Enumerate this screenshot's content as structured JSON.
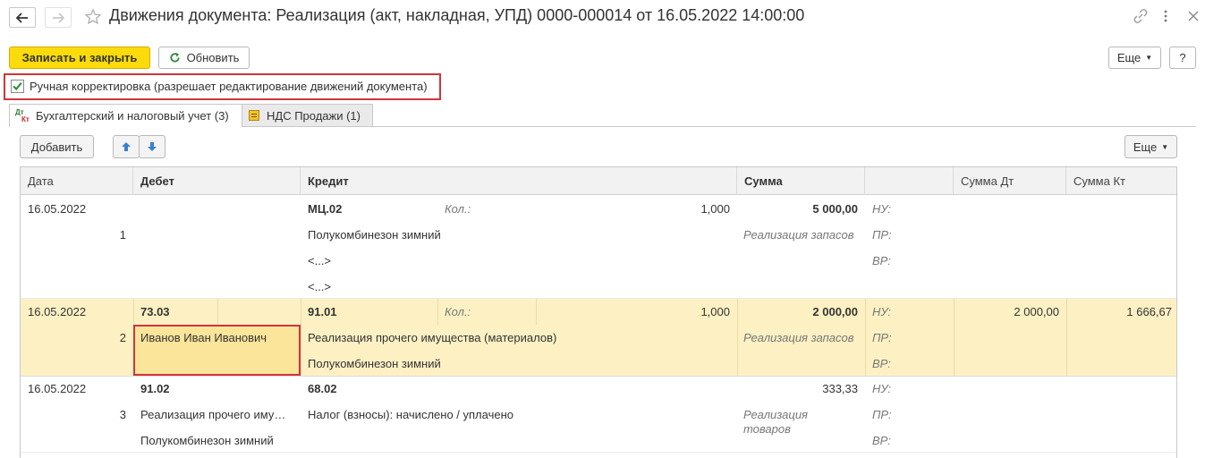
{
  "window": {
    "title": "Движения документа: Реализация (акт, накладная, УПД) 0000-000014 от 16.05.2022 14:00:00"
  },
  "toolbar": {
    "save_close_label": "Записать и закрыть",
    "refresh_label": "Обновить",
    "more_label": "Еще",
    "help_label": "?"
  },
  "manual_correction": {
    "checked": true,
    "label": "Ручная корректировка (разрешает редактирование движений документа)"
  },
  "tabs": [
    {
      "label": "Бухгалтерский и налоговый учет (3)",
      "icon_text_top": "Дт",
      "icon_text_bottom": "Кт",
      "active": true
    },
    {
      "label": "НДС Продажи (1)",
      "active": false
    }
  ],
  "grid_toolbar": {
    "add_label": "Добавить",
    "more_label": "Еще"
  },
  "columns": [
    "Дата",
    "Дебет",
    "Кредит",
    "Сумма",
    "",
    "Сумма Дт",
    "Сумма Кт"
  ],
  "rows": [
    {
      "date": "16.05.2022",
      "num": "1",
      "debit": [
        "",
        "",
        ""
      ],
      "credit": [
        "МЦ.02",
        "Полукомбинезон зимний",
        "<...>",
        "<...>"
      ],
      "qty_label": "Кол.:",
      "qty": "1,000",
      "sum": "5 000,00",
      "content": "Реализация запасов",
      "nu": "НУ:",
      "pr": "ПР:",
      "vr": "ВР:",
      "sum_dt": "",
      "sum_kt": ""
    },
    {
      "date": "16.05.2022",
      "num": "2",
      "debit": [
        "73.03",
        "Иванов Иван Иванович",
        ""
      ],
      "credit": [
        "91.01",
        "Реализация прочего имущества (материалов)",
        "Полукомбинезон зимний"
      ],
      "qty_label": "Кол.:",
      "qty": "1,000",
      "sum": "2 000,00",
      "content": "Реализация запасов",
      "nu": "НУ:",
      "pr": "ПР:",
      "vr": "ВР:",
      "sum_dt": "2 000,00",
      "sum_kt": "1 666,67"
    },
    {
      "date": "16.05.2022",
      "num": "3",
      "debit": [
        "91.02",
        "Реализация прочего иму…",
        "Полукомбинезон зимний"
      ],
      "credit": [
        "68.02",
        "Налог (взносы): начислено / уплачено",
        ""
      ],
      "qty_label": "",
      "qty": "",
      "sum": "333,33",
      "content_line1": "Реализация",
      "content_line2": "товаров",
      "nu": "НУ:",
      "pr": "ПР:",
      "vr": "ВР:",
      "sum_dt": "",
      "sum_kt": ""
    }
  ],
  "colors": {
    "primary_button": "#fcdb0a",
    "selected_row": "#fdf1c4",
    "highlight_cell": "#fbe59a",
    "annotation_red": "#d0343b",
    "checkbox_green": "#2e8b3a"
  }
}
